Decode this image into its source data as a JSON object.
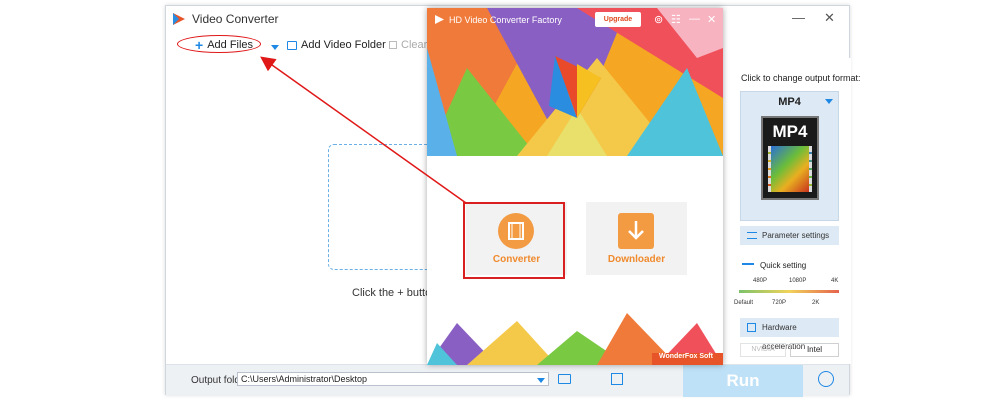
{
  "main_window": {
    "title": "Video Converter",
    "controls": [
      "—",
      "✕"
    ],
    "toolbar": {
      "add_files": "Add Files",
      "add_folder": "Add Video Folder",
      "clear": "Clear"
    },
    "drop_hint": "Click the + button to a",
    "output_folder_label": "Output folder:",
    "output_folder_value": "C:\\Users\\Administrator\\Desktop",
    "run_label": "Run"
  },
  "right_panel": {
    "change_format_label": "Click to change output format:",
    "format_name": "MP4",
    "format_icon_text": "MP4",
    "parameter_settings": "Parameter settings",
    "quick_setting": "Quick setting",
    "quality_ticks_top": [
      "480P",
      "1080P",
      "4K"
    ],
    "quality_ticks_bottom": [
      "Default",
      "720P",
      "2K"
    ],
    "hardware_acceleration": "Hardware acceleration",
    "nvidia": "NVIDIA",
    "intel": "Intel"
  },
  "overlay_window": {
    "title": "HD Video Converter Factory",
    "upgrade": "Upgrade",
    "controls": [
      "⊚",
      "☷",
      "—",
      "✕"
    ],
    "converter_label": "Converter",
    "downloader_label": "Downloader",
    "brand": "WonderFox Soft"
  },
  "colors": {
    "accent_blue": "#1e88e5",
    "highlight_red": "#e01818",
    "card_orange": "#f29b43",
    "run_button": "#bfe1f7"
  }
}
